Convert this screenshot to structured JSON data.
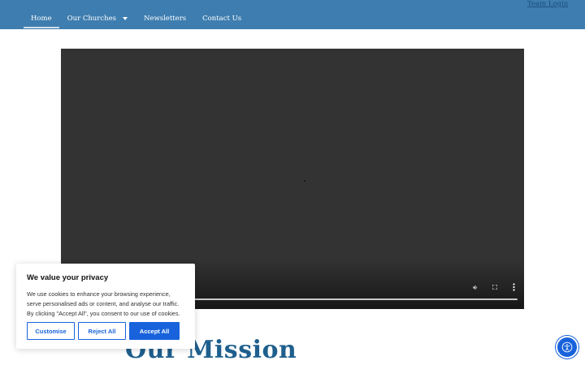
{
  "nav": {
    "items": [
      {
        "label": "Home",
        "active": true
      },
      {
        "label": "Our Churches",
        "has_dropdown": true
      },
      {
        "label": "Newsletters"
      },
      {
        "label": "Contact Us"
      }
    ],
    "team_login": "Team Login"
  },
  "video": {
    "controls": [
      "volume-icon",
      "fullscreen-icon",
      "more-options-icon"
    ]
  },
  "section": {
    "heading": "Our Mission"
  },
  "cookie_banner": {
    "title": "We value your privacy",
    "text": "We use cookies to enhance your browsing experience, serve personalised ads or content, and analyse our traffic. By clicking \"Accept All\", you consent to our use of cookies.",
    "customise_label": "Customise",
    "reject_label": "Reject All",
    "accept_label": "Accept All"
  },
  "colors": {
    "header_bg": "#3e7daf",
    "accent": "#1863dc",
    "heading": "#1f5f8d",
    "video_bg": "#333333"
  }
}
